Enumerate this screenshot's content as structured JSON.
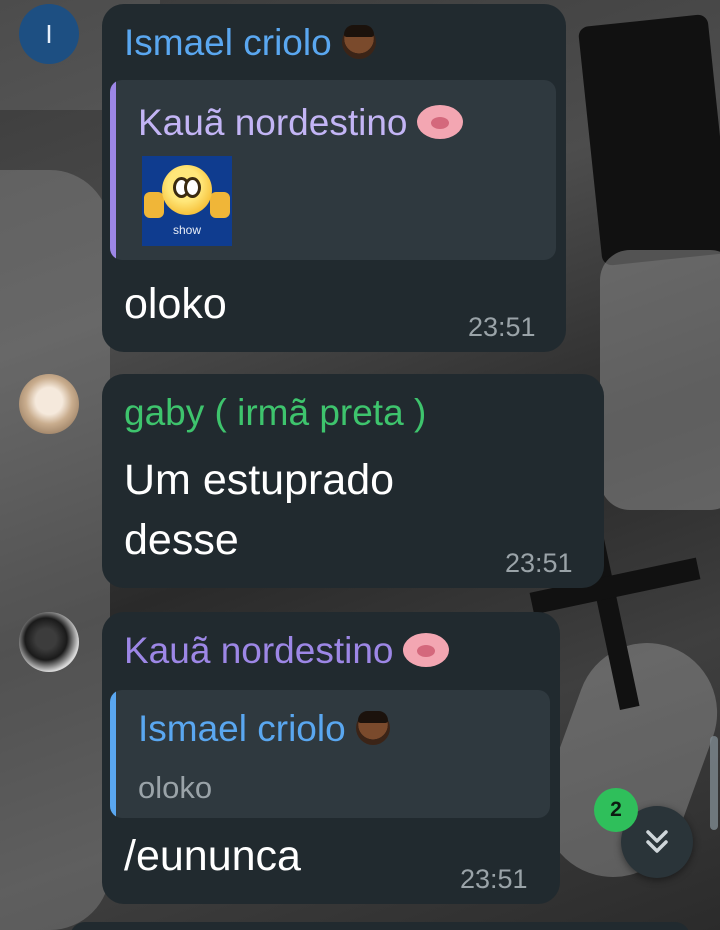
{
  "colors": {
    "bubble_bg": "#212a2f",
    "quote_bg": "#2f393f",
    "ismael_name": "#5aa7f0",
    "kaua_name": "#9d87e6",
    "kaua_quote_name": "#c3b5f5",
    "gaby_name": "#3ec46d",
    "timestamp": "#9aa3a8",
    "unread_badge": "#2fbf5b"
  },
  "messages": [
    {
      "avatar_letter": "I",
      "sender": "Ismael criolo",
      "sender_emoji": "man-dark-skin-tone-icon",
      "reply": {
        "sender": "Kauã nordestino",
        "sender_emoji": "pig-face-icon",
        "media_label": "show"
      },
      "text": "oloko",
      "time": "23:51"
    },
    {
      "sender": "gaby ( irmã preta )",
      "text_line1": "Um estuprado",
      "text_line2": "desse",
      "time": "23:51"
    },
    {
      "sender": "Kauã nordestino",
      "sender_emoji": "pig-face-icon",
      "reply": {
        "sender": "Ismael criolo",
        "sender_emoji": "man-dark-skin-tone-icon",
        "text": "oloko"
      },
      "text": "/eununca",
      "time": "23:51"
    }
  ],
  "scroll_down": {
    "unread_count": "2",
    "icon": "double-chevron-down-icon"
  }
}
